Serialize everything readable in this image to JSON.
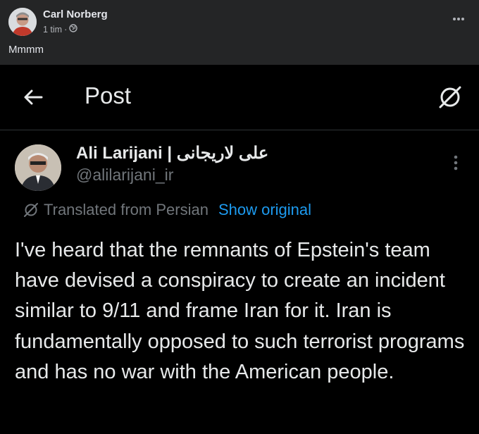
{
  "facebook_post": {
    "author": "Carl Norberg",
    "time": "1 tim",
    "separator": "·",
    "privacy_icon": "globe-icon",
    "more_icon": "more-horizontal-icon",
    "text": "Mmmm"
  },
  "x_screenshot": {
    "header": {
      "back_icon": "back-arrow-icon",
      "title": "Post",
      "right_icon": "grok-icon"
    },
    "tweet": {
      "display_name": "Ali Larijani | علی لاریجانی",
      "handle": "@alilarijani_ir",
      "more_icon": "more-vertical-icon",
      "translated_label": "Translated from Persian",
      "show_original": "Show original",
      "text": "I've heard that the remnants of Epstein's team have devised a conspiracy to create an incident similar to 9/11 and frame Iran for it. Iran is fundamentally opposed to such terrorist programs and has no war with the American people."
    }
  },
  "colors": {
    "fb_background": "#242526",
    "x_background": "#000000",
    "x_link": "#1d9bf0",
    "x_secondary": "#71767b"
  }
}
